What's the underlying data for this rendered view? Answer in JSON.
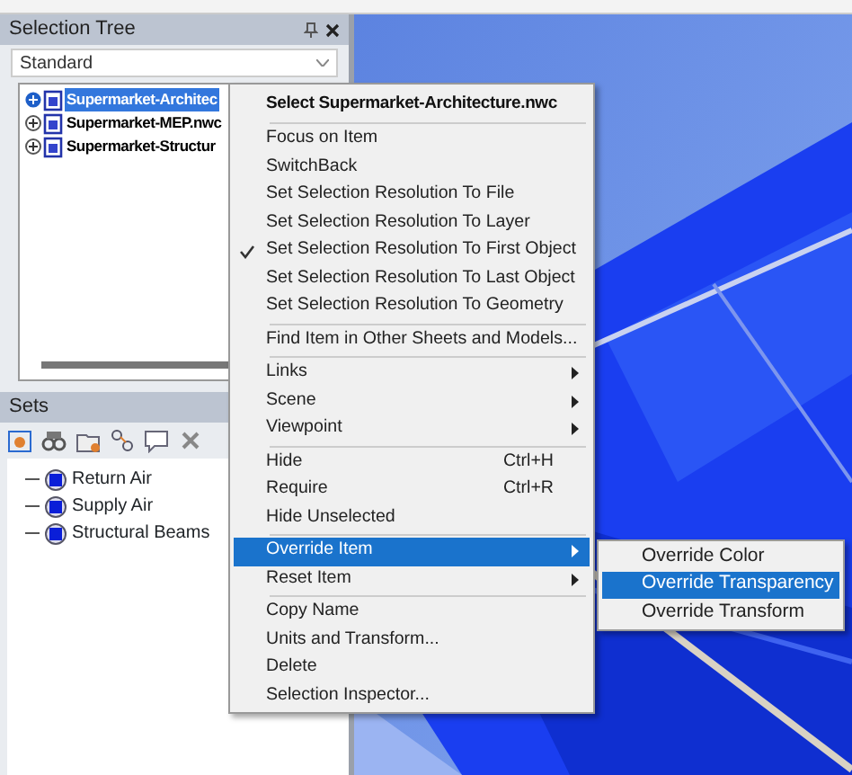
{
  "selection_tree": {
    "title": "Selection Tree",
    "dropdown": "Standard",
    "items": [
      {
        "label": "Supermarket-Architec",
        "selected": true
      },
      {
        "label": "Supermarket-MEP.nwc",
        "selected": false
      },
      {
        "label": "Supermarket-Structur",
        "selected": false
      }
    ]
  },
  "sets": {
    "title": "Sets",
    "items": [
      {
        "label": "Return Air"
      },
      {
        "label": "Supply Air"
      },
      {
        "label": "Structural Beams"
      }
    ]
  },
  "context_menu": {
    "header": "Select Supermarket-Architecture.nwc",
    "groups": [
      [
        {
          "label": "Focus on Item",
          "checked": false,
          "submenu": false,
          "selected": false
        },
        {
          "label": "SwitchBack",
          "checked": false,
          "submenu": false,
          "selected": false
        },
        {
          "label": "Set Selection Resolution To File",
          "checked": false,
          "submenu": false,
          "selected": false
        },
        {
          "label": "Set Selection Resolution To Layer",
          "checked": false,
          "submenu": false,
          "selected": false
        },
        {
          "label": "Set Selection Resolution To First Object",
          "checked": true,
          "submenu": false,
          "selected": false
        },
        {
          "label": "Set Selection Resolution To Last Object",
          "checked": false,
          "submenu": false,
          "selected": false
        },
        {
          "label": "Set Selection Resolution To Geometry",
          "checked": false,
          "submenu": false,
          "selected": false
        }
      ],
      [
        {
          "label": "Find Item in Other Sheets and Models...",
          "checked": false,
          "submenu": false,
          "selected": false
        }
      ],
      [
        {
          "label": "Links",
          "checked": false,
          "submenu": true,
          "selected": false
        },
        {
          "label": "Scene",
          "checked": false,
          "submenu": true,
          "selected": false
        },
        {
          "label": "Viewpoint",
          "checked": false,
          "submenu": true,
          "selected": false
        }
      ],
      [
        {
          "label": "Hide",
          "shortcut": "Ctrl+H",
          "checked": false,
          "submenu": false,
          "selected": false
        },
        {
          "label": "Require",
          "shortcut": "Ctrl+R",
          "checked": false,
          "submenu": false,
          "selected": false
        },
        {
          "label": "Hide Unselected",
          "checked": false,
          "submenu": false,
          "selected": false
        }
      ],
      [
        {
          "label": "Override Item",
          "checked": false,
          "submenu": true,
          "selected": true
        },
        {
          "label": "Reset Item",
          "checked": false,
          "submenu": true,
          "selected": false
        }
      ],
      [
        {
          "label": "Copy Name",
          "checked": false,
          "submenu": false,
          "selected": false
        },
        {
          "label": "Units and Transform...",
          "checked": false,
          "submenu": false,
          "selected": false
        },
        {
          "label": "Delete",
          "checked": false,
          "submenu": false,
          "selected": false
        },
        {
          "label": "Selection Inspector...",
          "checked": false,
          "submenu": false,
          "selected": false
        }
      ]
    ]
  },
  "submenu": {
    "items": [
      {
        "label": "Override Color",
        "selected": false
      },
      {
        "label": "Override Transparency",
        "selected": true
      },
      {
        "label": "Override Transform",
        "selected": false
      }
    ]
  }
}
